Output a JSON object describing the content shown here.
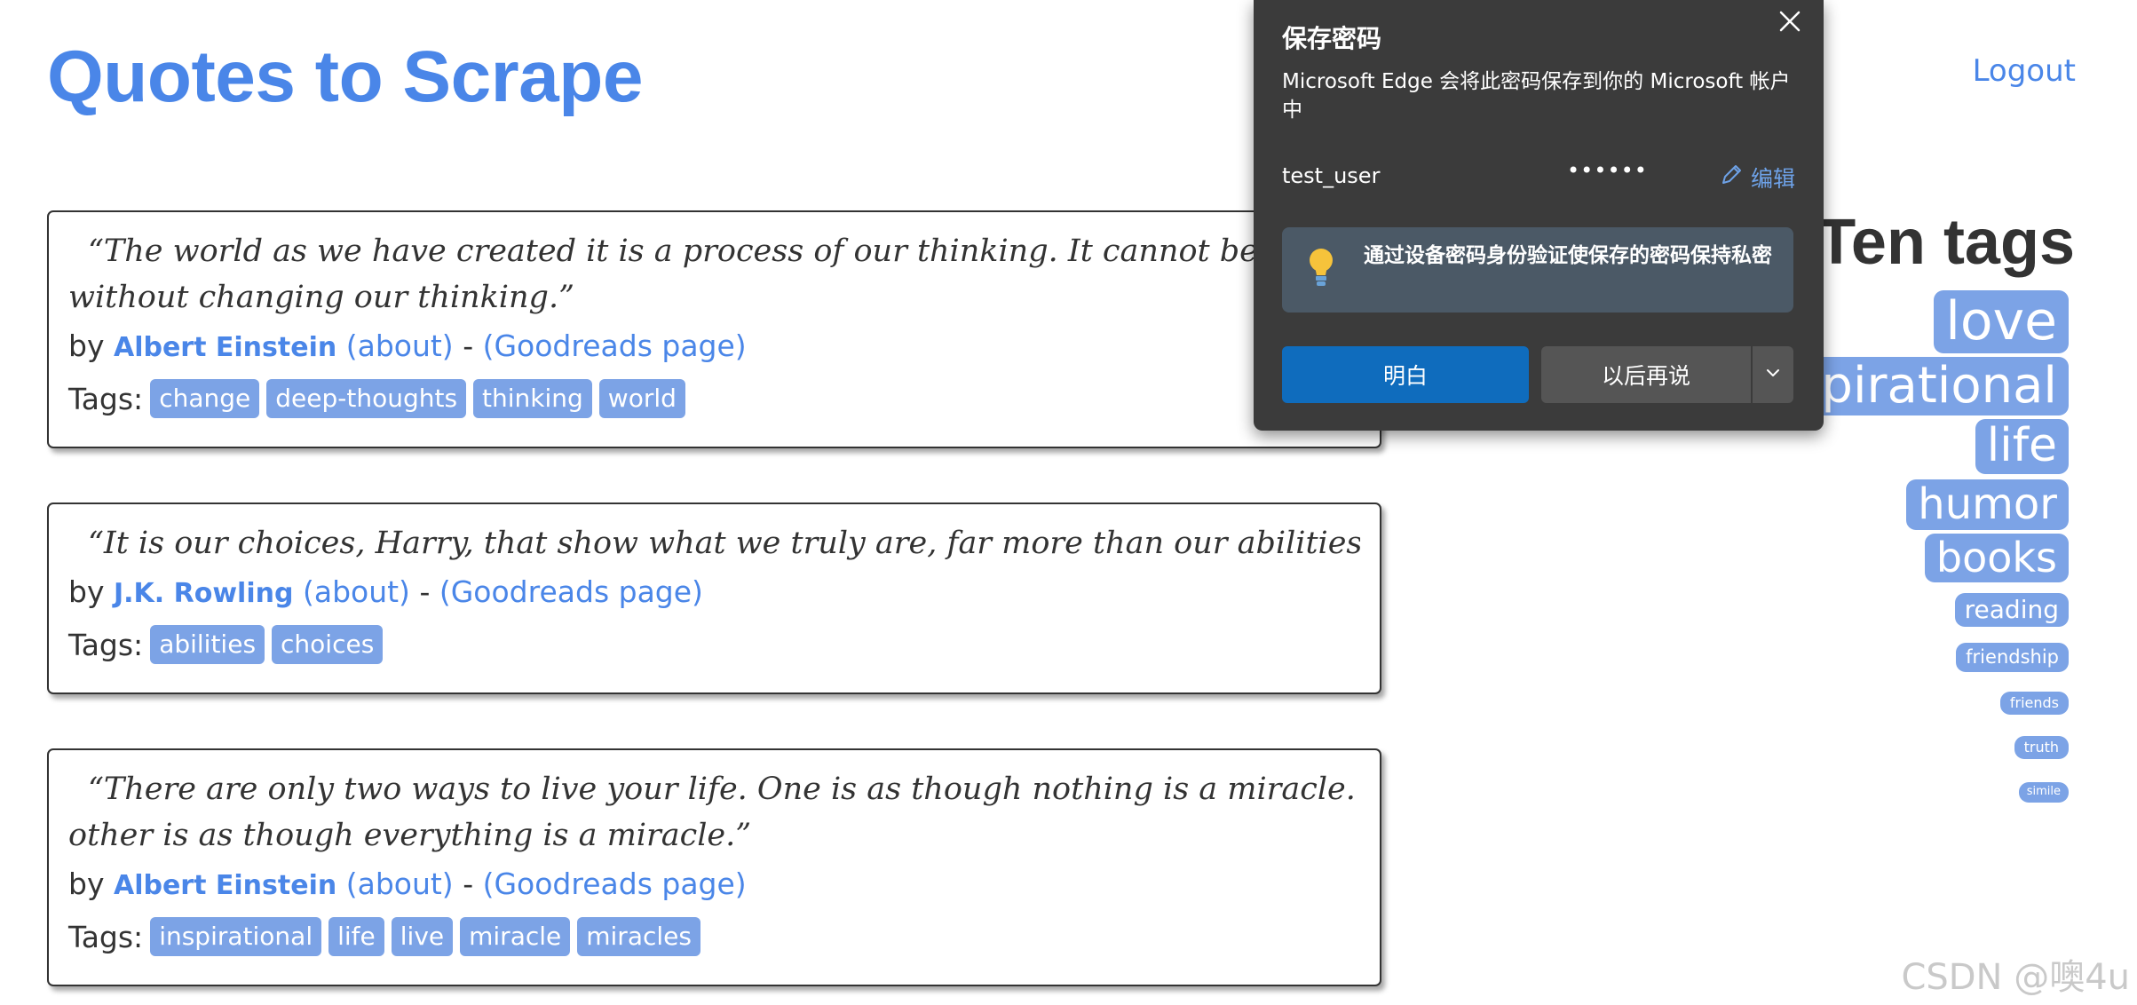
{
  "header": {
    "title": "Quotes to Scrape",
    "logout": "Logout"
  },
  "tags_label": "Tags:",
  "by_label": "by",
  "separator": "-",
  "quotes": [
    {
      "text_line1": "“The world as we have created it is a process of our thinking. It cannot be changed",
      "text_line2": "without changing our thinking.”",
      "author": "Albert Einstein",
      "about": "(about)",
      "goodreads": "(Goodreads page)",
      "tags": [
        "change",
        "deep-thoughts",
        "thinking",
        "world"
      ]
    },
    {
      "text_line1": "“It is our choices, Harry, that show what we truly are, far more than our abilities.”",
      "text_line2": "",
      "author": "J.K. Rowling",
      "about": "(about)",
      "goodreads": "(Goodreads page)",
      "tags": [
        "abilities",
        "choices"
      ]
    },
    {
      "text_line1": "“There are only two ways to live your life. One is as though nothing is a miracle. The",
      "text_line2": "other is as though everything is a miracle.”",
      "author": "Albert Einstein",
      "about": "(about)",
      "goodreads": "(Goodreads page)",
      "tags": [
        "inspirational",
        "life",
        "live",
        "miracle",
        "miracles"
      ]
    }
  ],
  "top_tags": {
    "heading": "Ten tags",
    "items": [
      "love",
      "inspirational",
      "life",
      "humor",
      "books",
      "reading",
      "friendship",
      "friends",
      "truth",
      "simile"
    ]
  },
  "popup": {
    "title": "保存密码",
    "description": "Microsoft Edge 会将此密码保存到你的 Microsoft 帐户中",
    "username": "test_user",
    "password_mask": "••••••",
    "edit_label": "编辑",
    "notice": "通过设备密码身份验证使保存的密码保持私密",
    "primary_button": "明白",
    "secondary_button": "以后再说"
  },
  "watermark": "CSDN @噢4u",
  "colors": {
    "link": "#4a86e8",
    "tag_bg": "#7ca3e6",
    "popup_bg": "#3b3b3b",
    "primary_button": "#0f6cbd"
  }
}
